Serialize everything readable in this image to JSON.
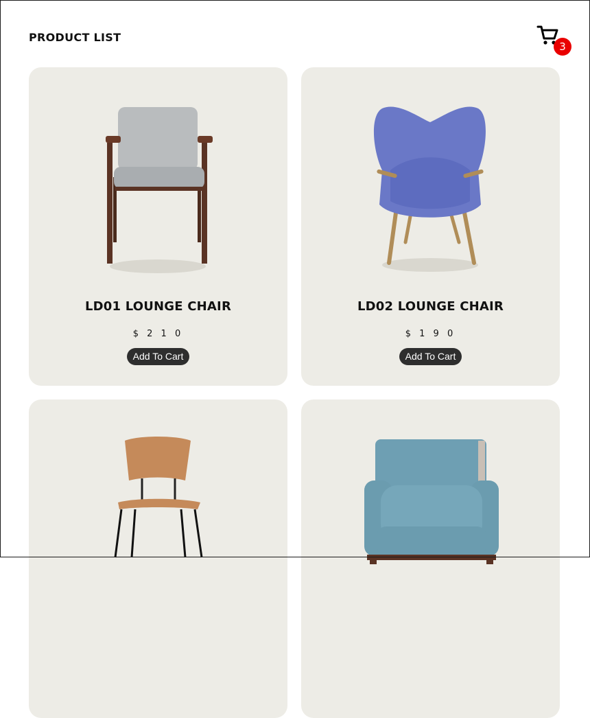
{
  "header": {
    "title": "PRODUCT LIST",
    "cart_icon": "shopping-cart-icon",
    "cart_count": "3"
  },
  "colors": {
    "card_bg": "#edece6",
    "badge": "#e90000",
    "button": "#2e2e2e"
  },
  "products": [
    {
      "name": "LD01 LOUNGE CHAIR",
      "price": "$ 2 1 0",
      "button": "Add To Cart"
    },
    {
      "name": "LD02 LOUNGE CHAIR",
      "price": "$ 1 9 0",
      "button": "Add To Cart"
    },
    {
      "name": "",
      "price": "",
      "button": ""
    },
    {
      "name": "",
      "price": "",
      "button": ""
    }
  ]
}
